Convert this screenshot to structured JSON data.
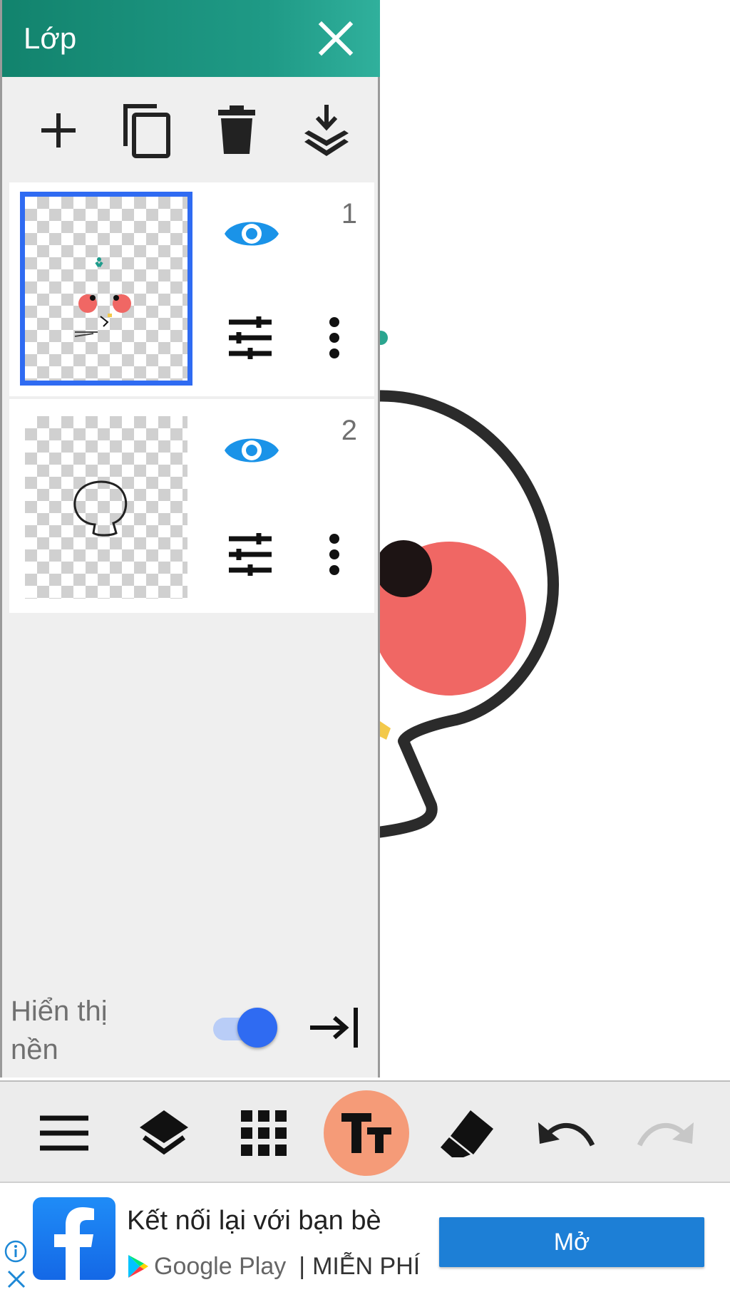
{
  "panel": {
    "title": "Lớp",
    "tools": [
      {
        "name": "add-layer",
        "icon": "plus-icon"
      },
      {
        "name": "duplicate-layer",
        "icon": "copy-icon"
      },
      {
        "name": "delete-layer",
        "icon": "trash-icon"
      },
      {
        "name": "merge-down",
        "icon": "merge-down-icon"
      }
    ],
    "layers": [
      {
        "number": "1",
        "visible": true,
        "selected": true
      },
      {
        "number": "2",
        "visible": true,
        "selected": false
      }
    ],
    "background_label": "Hiển thị nền",
    "background_toggle_on": true
  },
  "bottom_toolbar": {
    "items": [
      {
        "name": "menu",
        "icon": "hamburger-icon"
      },
      {
        "name": "layers",
        "icon": "layers-icon"
      },
      {
        "name": "grid",
        "icon": "grid-icon"
      },
      {
        "name": "text",
        "icon": "text-icon",
        "active": true
      },
      {
        "name": "eraser",
        "icon": "eraser-icon"
      },
      {
        "name": "undo",
        "icon": "undo-icon"
      },
      {
        "name": "redo",
        "icon": "redo-icon",
        "disabled": true
      }
    ]
  },
  "ad": {
    "headline": "Kết nối lại với bạn bè",
    "store": "Google Play",
    "price": "MIỄN PHÍ",
    "separator": "|",
    "cta": "Mở"
  },
  "colors": {
    "header": "#12836d",
    "accent_blue": "#2f6bf2",
    "eye_blue": "#1a93e8",
    "active_tool": "#f59b78",
    "ad_button": "#1d7fd6"
  }
}
